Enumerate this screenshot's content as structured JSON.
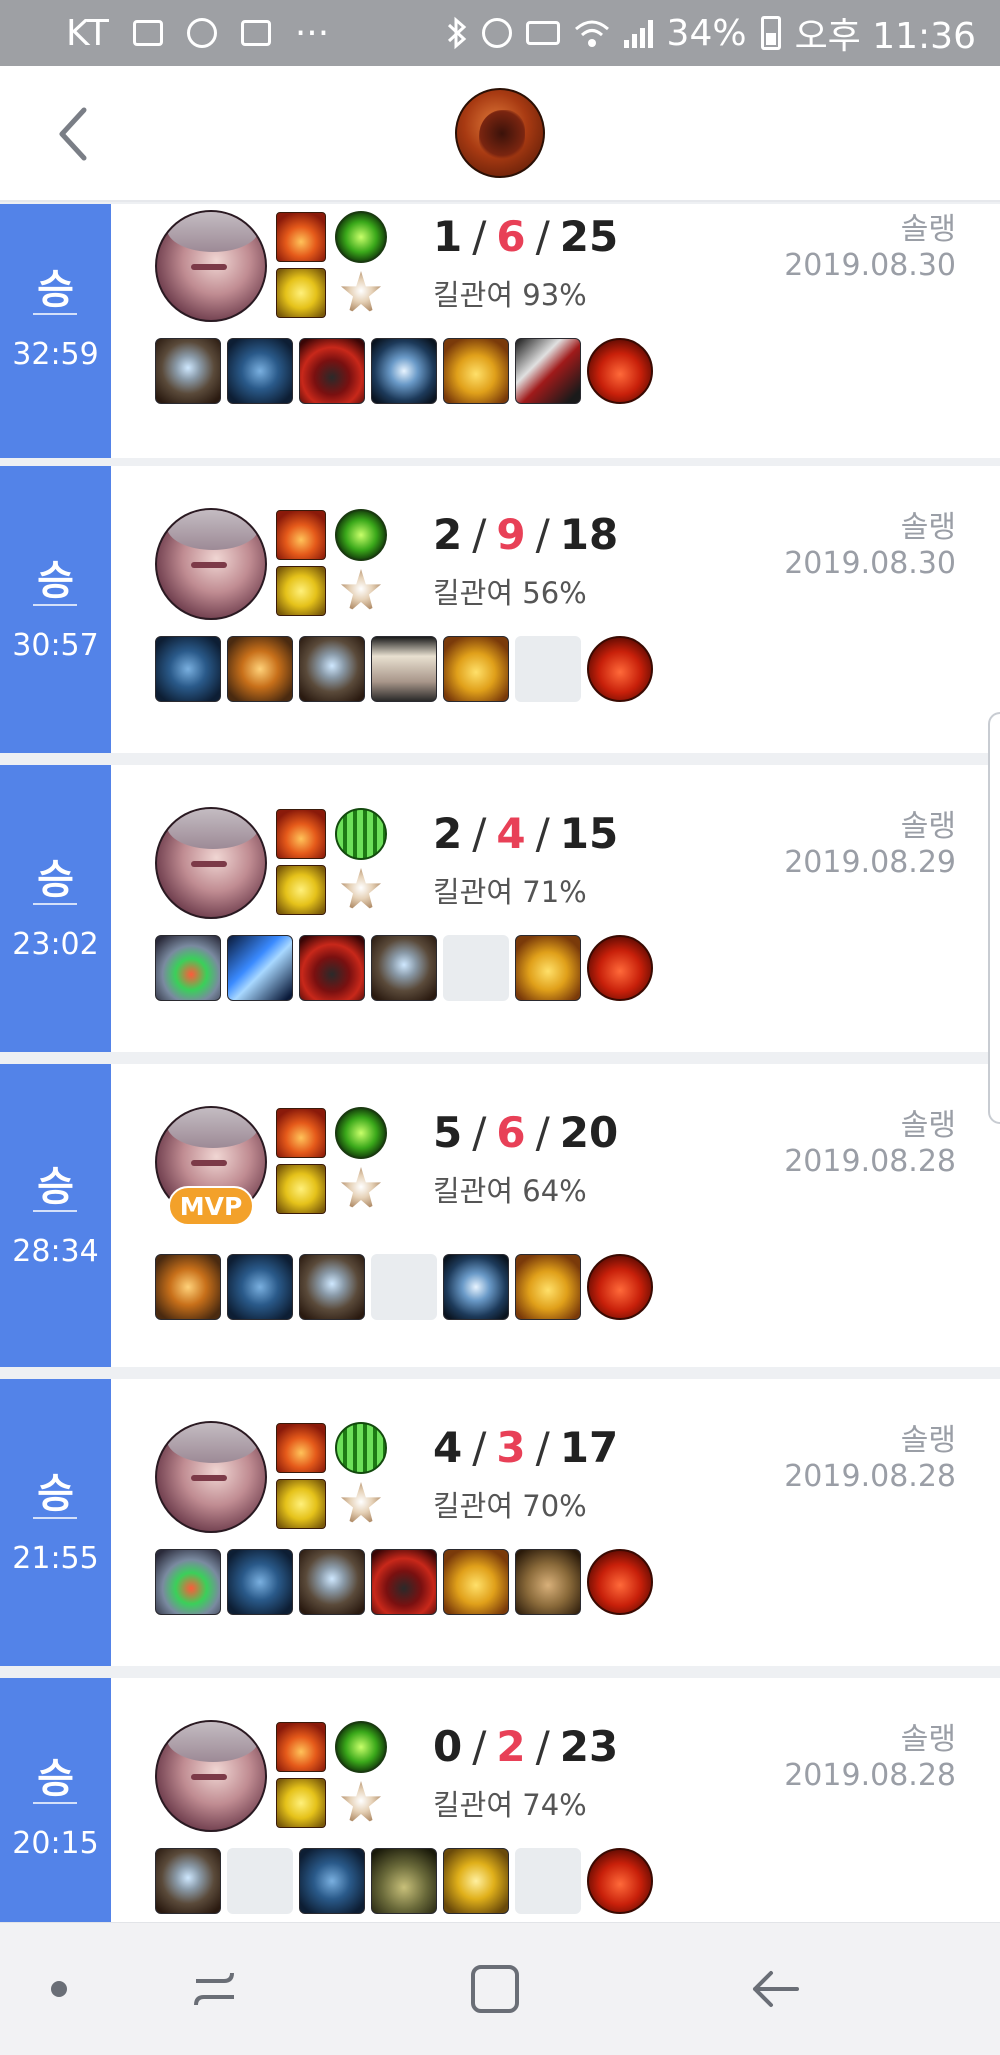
{
  "status_bar": {
    "carrier": "KT",
    "dots": "···",
    "battery": "34%",
    "time": "오후 11:36"
  },
  "header": {
    "back_icon": "chevron-left-icon",
    "champion_icon": "champion-icon"
  },
  "colors": {
    "win": "#5383e8",
    "deaths": "#e84057",
    "mvp": "#f3a12a"
  },
  "matches": [
    {
      "result": "승",
      "duration": "32:59",
      "kills": "1",
      "deaths": "6",
      "assists": "25",
      "kill_participation": "킬관여 93%",
      "queue": "솔랭",
      "date": "2019.08.30",
      "mvp": false,
      "rune_primary": "rune-green",
      "items": [
        "steel-item",
        "blue-item",
        "red-item",
        "hex-item",
        "boots-item",
        "blade-item",
        "trinket"
      ]
    },
    {
      "result": "승",
      "duration": "30:57",
      "kills": "2",
      "deaths": "9",
      "assists": "18",
      "kill_participation": "킬관여 56%",
      "queue": "솔랭",
      "date": "2019.08.30",
      "mvp": false,
      "rune_primary": "rune-green",
      "items": [
        "blue-item",
        "wings-item",
        "steel-item",
        "vest-item",
        "boots-item",
        "empty",
        "trinket"
      ]
    },
    {
      "result": "승",
      "duration": "23:02",
      "kills": "2",
      "deaths": "4",
      "assists": "15",
      "kill_participation": "킬관여 71%",
      "queue": "솔랭",
      "date": "2019.08.29",
      "mvp": false,
      "rune_primary": "rune-green2",
      "items": [
        "gem-item",
        "sword-item",
        "red-item",
        "steel-item",
        "empty",
        "boots-item",
        "trinket"
      ]
    },
    {
      "result": "승",
      "duration": "28:34",
      "kills": "5",
      "deaths": "6",
      "assists": "20",
      "kill_participation": "킬관여 64%",
      "queue": "솔랭",
      "date": "2019.08.28",
      "mvp": true,
      "mvp_label": "MVP",
      "rune_primary": "rune-green",
      "items": [
        "wings-item",
        "blue-item",
        "steel-item",
        "empty",
        "hex-item",
        "boots-item",
        "trinket"
      ]
    },
    {
      "result": "승",
      "duration": "21:55",
      "kills": "4",
      "deaths": "3",
      "assists": "17",
      "kill_participation": "킬관여 70%",
      "queue": "솔랭",
      "date": "2019.08.28",
      "mvp": false,
      "rune_primary": "rune-green2",
      "items": [
        "gem-item",
        "blue-item",
        "steel-item",
        "red-item",
        "boots-item",
        "cloak-item",
        "trinket"
      ]
    },
    {
      "result": "승",
      "duration": "20:15",
      "kills": "0",
      "deaths": "2",
      "assists": "23",
      "kill_participation": "킬관여 74%",
      "queue": "솔랭",
      "date": "2019.08.28",
      "mvp": false,
      "rune_primary": "rune-green",
      "items": [
        "steel-item",
        "empty",
        "blue-item",
        "hat-item",
        "shield-item",
        "empty",
        "trinket"
      ]
    }
  ]
}
